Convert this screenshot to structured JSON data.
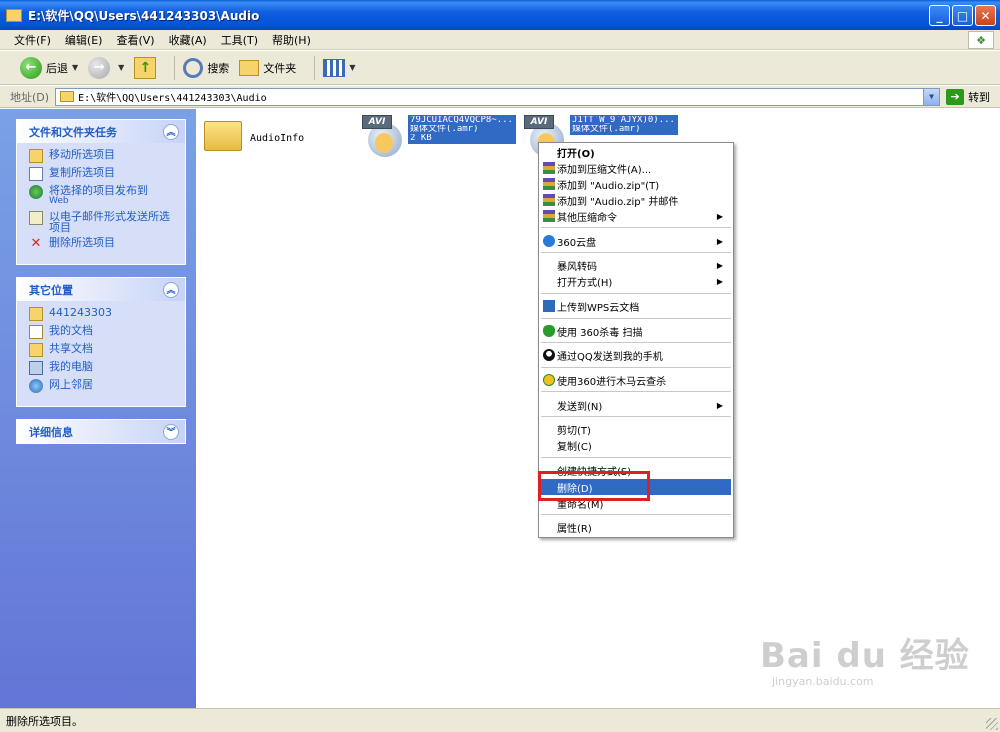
{
  "window": {
    "title": "E:\\软件\\QQ\\Users\\441243303\\Audio"
  },
  "menubar": {
    "items": [
      "文件(F)",
      "编辑(E)",
      "查看(V)",
      "收藏(A)",
      "工具(T)",
      "帮助(H)"
    ]
  },
  "toolbar": {
    "back": "后退",
    "search": "搜索",
    "folders": "文件夹"
  },
  "address": {
    "label": "地址(D)",
    "path": "E:\\软件\\QQ\\Users\\441243303\\Audio",
    "go": "转到"
  },
  "tasks_panel": {
    "title": "文件和文件夹任务",
    "items": [
      {
        "label": "移动所选项目"
      },
      {
        "label": "复制所选项目"
      },
      {
        "label": "将选择的项目发布到",
        "sub": "Web"
      },
      {
        "label": "以电子邮件形式发送所选项目"
      },
      {
        "label": "删除所选项目"
      }
    ]
  },
  "places_panel": {
    "title": "其它位置",
    "items": [
      "441243303",
      "我的文档",
      "共享文档",
      "我的电脑",
      "网上邻居"
    ]
  },
  "details_panel": {
    "title": "详细信息"
  },
  "files": [
    {
      "name": "AudioInfo"
    },
    {
      "tag": "AVI",
      "name": "79JCUIACQ4VQCP8~...",
      "type": "媒体文件(.amr)",
      "size": "2 KB"
    },
    {
      "tag": "AVI",
      "name": "J1TT`W_9`AJYX)0)...",
      "type": "媒体文件(.amr)"
    }
  ],
  "context_menu": {
    "items": [
      "打开(O)",
      "添加到压缩文件(A)...",
      "添加到 \"Audio.zip\"(T)",
      "添加到 \"Audio.zip\" 并邮件",
      "其他压缩命令",
      "360云盘",
      "暴风转码",
      "打开方式(H)",
      "上传到WPS云文档",
      "使用 360杀毒 扫描",
      "通过QQ发送到我的手机",
      "使用360进行木马云查杀",
      "发送到(N)",
      "剪切(T)",
      "复制(C)",
      "创建快捷方式(S)",
      "删除(D)",
      "重命名(M)",
      "属性(R)"
    ]
  },
  "status": {
    "text": "删除所选项目。"
  },
  "watermark": {
    "logo": "Bai du 经验",
    "url": "jingyan.baidu.com"
  }
}
